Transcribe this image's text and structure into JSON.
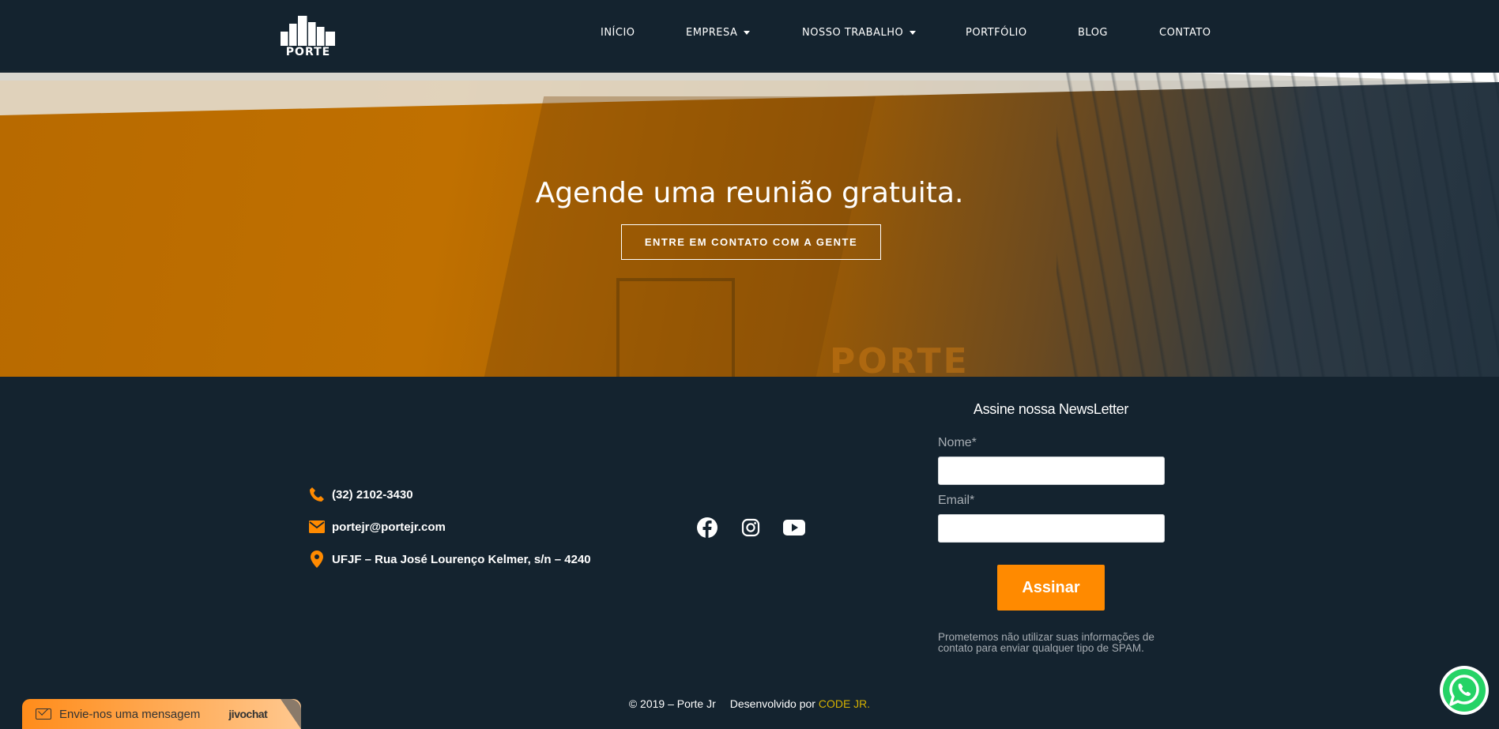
{
  "header": {
    "logo_text": "PORTE",
    "nav": [
      {
        "label": "INÍCIO",
        "has_dropdown": false
      },
      {
        "label": "EMPRESA",
        "has_dropdown": true
      },
      {
        "label": "NOSSO TRABALHO",
        "has_dropdown": true
      },
      {
        "label": "PORTFÓLIO",
        "has_dropdown": false
      },
      {
        "label": "BLOG",
        "has_dropdown": false
      },
      {
        "label": "CONTATO",
        "has_dropdown": false
      }
    ]
  },
  "hero": {
    "title": "Agende uma reunião gratuita.",
    "button_label": "ENTRE EM CONTATO COM A GENTE",
    "background_logo_text": "PORTE"
  },
  "contact": {
    "phone": "(32) 2102-3430",
    "email": "portejr@portejr.com",
    "address": "UFJF – Rua José Lourenço Kelmer, s/n – 4240",
    "icons": [
      "phone-icon",
      "envelope-icon",
      "map-pin-icon"
    ]
  },
  "social": [
    "facebook-icon",
    "instagram-icon",
    "youtube-icon"
  ],
  "newsletter": {
    "title": "Assine nossa  NewsLetter",
    "name_label": "Nome*",
    "name_value": "",
    "email_label": "Email*",
    "email_value": "",
    "submit_label": "Assinar",
    "note": "Prometemos não utilizar suas informações de contato para enviar qualquer tipo de SPAM."
  },
  "footer": {
    "copyright": "© 2019 – Porte Jr",
    "developed_by": "Desenvolvido por",
    "developer": "CODE JR."
  },
  "chat_widget": {
    "message": "Envie-nos uma mensagem",
    "brand": "jivochat"
  },
  "colors": {
    "background": "#14232f",
    "accent": "#ff8a00",
    "credit_link": "#d4b000"
  }
}
